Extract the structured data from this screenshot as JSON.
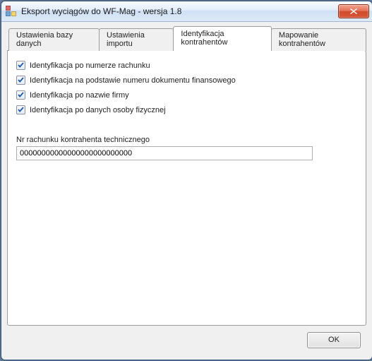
{
  "window": {
    "title": "Eksport wyciągów do WF-Mag - wersja 1.8"
  },
  "tabs": [
    {
      "label": "Ustawienia bazy danych",
      "active": false
    },
    {
      "label": "Ustawienia importu",
      "active": false
    },
    {
      "label": "Identyfikacja kontrahentów",
      "active": true
    },
    {
      "label": "Mapowanie kontrahentów",
      "active": false
    }
  ],
  "identification": {
    "checks": [
      {
        "label": "Identyfikacja po numerze rachunku",
        "checked": true
      },
      {
        "label": "Identyfikacja na podstawie numeru dokumentu finansowego",
        "checked": true
      },
      {
        "label": "Identyfikacja po nazwie firmy",
        "checked": true
      },
      {
        "label": "Identyfikacja po danych osoby fizycznej",
        "checked": true
      }
    ],
    "account_label": "Nr rachunku kontrahenta technicznego",
    "account_value": "00000000000000000000000000"
  },
  "footer": {
    "ok_label": "OK"
  }
}
